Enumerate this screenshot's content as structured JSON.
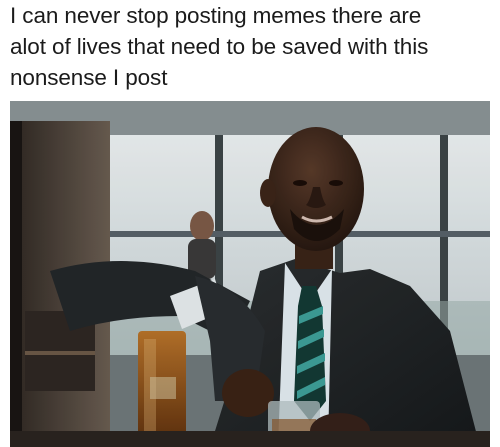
{
  "caption": {
    "lines": [
      "I can never stop posting memes there are",
      "alot of lives that need to be saved with this",
      "nonsense I post"
    ]
  },
  "photo": {
    "icon": "man-pouring-whiskey-photo"
  }
}
